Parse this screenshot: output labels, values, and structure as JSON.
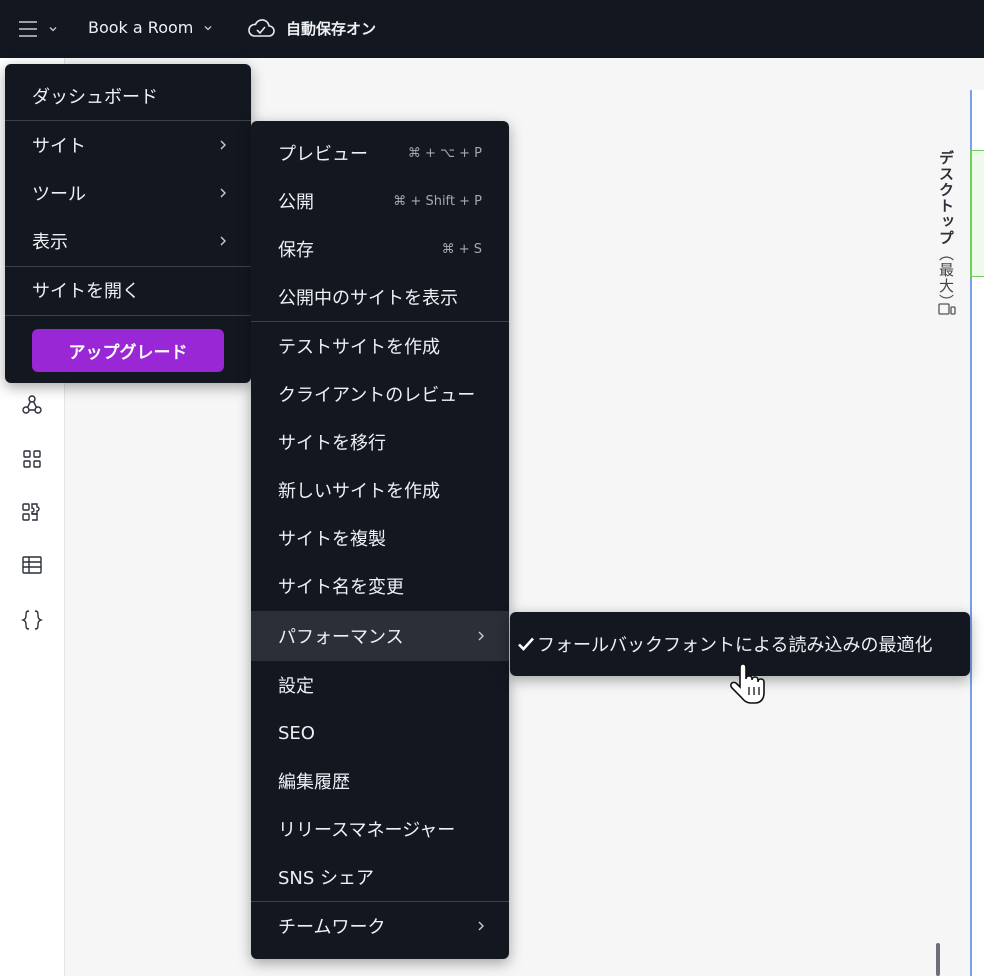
{
  "topbar": {
    "menu_icon": "hamburger-icon",
    "site_name": "Book a Room",
    "autosave_icon": "cloud-check-icon",
    "autosave_label": "自動保存オン"
  },
  "sidebar": {
    "icons": [
      "apps-network-icon",
      "grid-icon",
      "puzzle-icon",
      "table-icon",
      "code-braces-icon"
    ]
  },
  "canvas": {
    "device_label_main": "デスクトップ",
    "device_label_sub": "（最大）",
    "device_icon": "device-icon"
  },
  "main_menu": {
    "items": [
      {
        "label": "ダッシュボード"
      },
      {
        "label": "サイト",
        "submenu": true
      },
      {
        "label": "ツール",
        "submenu": true
      },
      {
        "label": "表示",
        "submenu": true
      },
      {
        "label": "サイトを開く"
      }
    ],
    "upgrade_label": "アップグレード"
  },
  "site_menu": {
    "items": [
      {
        "label": "プレビュー",
        "shortcut": "⌘ + ⌥ + P"
      },
      {
        "label": "公開",
        "shortcut": "⌘ + Shift + P"
      },
      {
        "label": "保存",
        "shortcut": "⌘ + S"
      },
      {
        "label": "公開中のサイトを表示"
      },
      {
        "label": "テストサイトを作成"
      },
      {
        "label": "クライアントのレビュー"
      },
      {
        "label": "サイトを移行"
      },
      {
        "label": "新しいサイトを作成"
      },
      {
        "label": "サイトを複製"
      },
      {
        "label": "サイト名を変更"
      },
      {
        "label": "パフォーマンス",
        "submenu": true
      },
      {
        "label": "設定"
      },
      {
        "label": "SEO"
      },
      {
        "label": "編集履歴"
      },
      {
        "label": "リリースマネージャー"
      },
      {
        "label": "SNS シェア"
      },
      {
        "label": "チームワーク",
        "submenu": true
      }
    ]
  },
  "performance_menu": {
    "item_label": "フォールバックフォントによる読み込みの最適化",
    "checked": true
  }
}
